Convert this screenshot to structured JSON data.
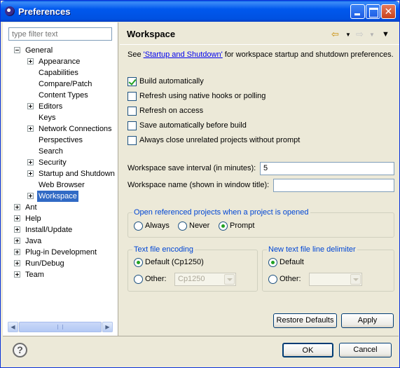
{
  "window": {
    "title": "Preferences"
  },
  "filter": {
    "placeholder": "type filter text"
  },
  "tree": [
    {
      "label": "General",
      "level": 0,
      "toggle": "minus"
    },
    {
      "label": "Appearance",
      "level": 1,
      "toggle": "plus"
    },
    {
      "label": "Capabilities",
      "level": 1,
      "toggle": ""
    },
    {
      "label": "Compare/Patch",
      "level": 1,
      "toggle": ""
    },
    {
      "label": "Content Types",
      "level": 1,
      "toggle": ""
    },
    {
      "label": "Editors",
      "level": 1,
      "toggle": "plus"
    },
    {
      "label": "Keys",
      "level": 1,
      "toggle": ""
    },
    {
      "label": "Network Connections",
      "level": 1,
      "toggle": "plus"
    },
    {
      "label": "Perspectives",
      "level": 1,
      "toggle": ""
    },
    {
      "label": "Search",
      "level": 1,
      "toggle": ""
    },
    {
      "label": "Security",
      "level": 1,
      "toggle": "plus"
    },
    {
      "label": "Startup and Shutdown",
      "level": 1,
      "toggle": "plus"
    },
    {
      "label": "Web Browser",
      "level": 1,
      "toggle": ""
    },
    {
      "label": "Workspace",
      "level": 1,
      "toggle": "plus",
      "selected": true
    },
    {
      "label": "Ant",
      "level": 0,
      "toggle": "plus"
    },
    {
      "label": "Help",
      "level": 0,
      "toggle": "plus"
    },
    {
      "label": "Install/Update",
      "level": 0,
      "toggle": "plus"
    },
    {
      "label": "Java",
      "level": 0,
      "toggle": "plus"
    },
    {
      "label": "Plug-in Development",
      "level": 0,
      "toggle": "plus"
    },
    {
      "label": "Run/Debug",
      "level": 0,
      "toggle": "plus"
    },
    {
      "label": "Team",
      "level": 0,
      "toggle": "plus"
    }
  ],
  "page": {
    "title": "Workspace",
    "nav_back": "⇦",
    "nav_forward": "⇨",
    "nav_menu": "▼",
    "desc_prefix": "See ",
    "desc_link": "'Startup and Shutdown'",
    "desc_suffix": " for workspace startup and shutdown preferences.",
    "checkboxes": [
      {
        "label": "Build automatically",
        "checked": true
      },
      {
        "label": "Refresh using native hooks or polling",
        "checked": false
      },
      {
        "label": "Refresh on access",
        "checked": false
      },
      {
        "label": "Save automatically before build",
        "checked": false
      },
      {
        "label": "Always close unrelated projects without prompt",
        "checked": false
      }
    ],
    "save_interval_label": "Workspace save interval (in minutes):",
    "save_interval_value": "5",
    "workspace_name_label": "Workspace name (shown in window title):",
    "workspace_name_value": "",
    "open_ref": {
      "title": "Open referenced projects when a project is opened",
      "options": [
        "Always",
        "Never",
        "Prompt"
      ],
      "selected": "Prompt"
    },
    "encoding": {
      "title": "Text file encoding",
      "default_label": "Default (Cp1250)",
      "other_label": "Other:",
      "other_value": "Cp1250",
      "selected": "default"
    },
    "delimiter": {
      "title": "New text file line delimiter",
      "default_label": "Default",
      "other_label": "Other:",
      "other_value": "",
      "selected": "default"
    },
    "restore_defaults": "Restore Defaults",
    "apply": "Apply"
  },
  "footer": {
    "help": "?",
    "ok": "OK",
    "cancel": "Cancel"
  },
  "colors": {
    "title_bar": "#0058ee",
    "selection": "#316ac5",
    "group_title": "#0046d5",
    "link": "#0000ee"
  }
}
